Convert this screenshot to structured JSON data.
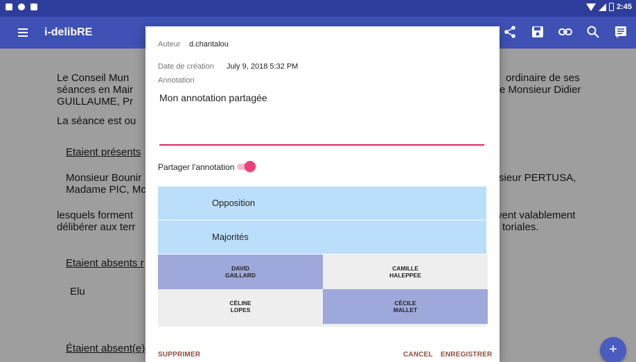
{
  "status_bar": {
    "time": "2:45"
  },
  "app_bar": {
    "title": "i-delibRE",
    "actions": [
      "share-icon",
      "save-icon",
      "link-icon",
      "search-icon",
      "annotations-icon"
    ]
  },
  "document": {
    "para1_left": "Le Conseil Mun",
    "para1_left2": "séances en Mair",
    "para1_left3": "GUILLAUME, Pr",
    "para1_right": "ordinaire de ses",
    "para1_right2": "e Monsieur Didier",
    "para2": "La séance est ou",
    "present_heading": "Etaient présents",
    "present_left": "Monsieur Bounir",
    "present_left2": "Madame PIC, Mc",
    "present_right": "sieur PERTUSA,",
    "quorum_left": "lesquels forment",
    "quorum_left2": "délibérer aux terr",
    "quorum_right": "vent valablement",
    "quorum_right2": "toriales.",
    "absent_heading": "Etaient absents r",
    "elu": "Elu",
    "absent2_heading": "Étaient absent(e)"
  },
  "fab": {
    "label": "+"
  },
  "dialog": {
    "author_label": "Auteur",
    "author_value": "d.chantalou",
    "date_label": "Date de création",
    "date_value": "July 9, 2018 5:32 PM",
    "annotation_label": "Annotation",
    "annotation_value": "Mon annotation partagée",
    "share_label": "Partager l'annotation",
    "share_enabled": true,
    "groups": [
      "Opposition",
      "Majorités"
    ],
    "people": [
      {
        "first": "DAVID",
        "last": "GAILLARD",
        "selected": true
      },
      {
        "first": "CAMILLE",
        "last": "HALEPPEE",
        "selected": false
      },
      {
        "first": "CÉLINE",
        "last": "LOPES",
        "selected": false
      },
      {
        "first": "CÉCILE",
        "last": "MALLET",
        "selected": true
      }
    ],
    "delete_label": "SUPPRIMER",
    "cancel_label": "CANCEL",
    "save_label": "ENREGISTRER"
  },
  "colors": {
    "app_bar": "#3f51b5",
    "status_bar": "#2e3d9b",
    "accent": "#e91e63",
    "group_bg": "#bbdefb",
    "selected_person": "#9fa8da",
    "button_text": "#8d4d3c"
  }
}
